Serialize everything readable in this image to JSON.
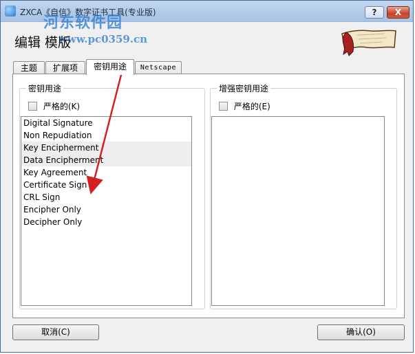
{
  "window": {
    "title": "ZXCA《自信》数字证书工具(专业版)",
    "watermark": "河东软件园",
    "watermark_url": "www.pc0359.cn",
    "help_label": "?",
    "close_label": "X"
  },
  "header": {
    "title": "编辑 模版"
  },
  "tabs": [
    {
      "label": "主题"
    },
    {
      "label": "扩展项"
    },
    {
      "label": "密钥用途"
    },
    {
      "label": "Netscape"
    }
  ],
  "key_usage": {
    "legend": "密钥用途",
    "critical_label": "严格的(K)",
    "critical_checked": false,
    "items": [
      "Digital Signature",
      "Non Repudiation",
      "Key Encipherment",
      "Data Encipherment",
      "Key Agreement",
      "Certificate Sign",
      "CRL Sign",
      "Encipher Only",
      "Decipher Only"
    ]
  },
  "extended_key_usage": {
    "legend": "增强密钥用途",
    "critical_label": "严格的(E)",
    "critical_checked": false
  },
  "buttons": {
    "cancel": "取消(C)",
    "ok": "确认(O)"
  },
  "colors": {
    "annotation_arrow": "#d42020",
    "titlebar": "#b3cbe8",
    "close_button": "#c7422a"
  }
}
